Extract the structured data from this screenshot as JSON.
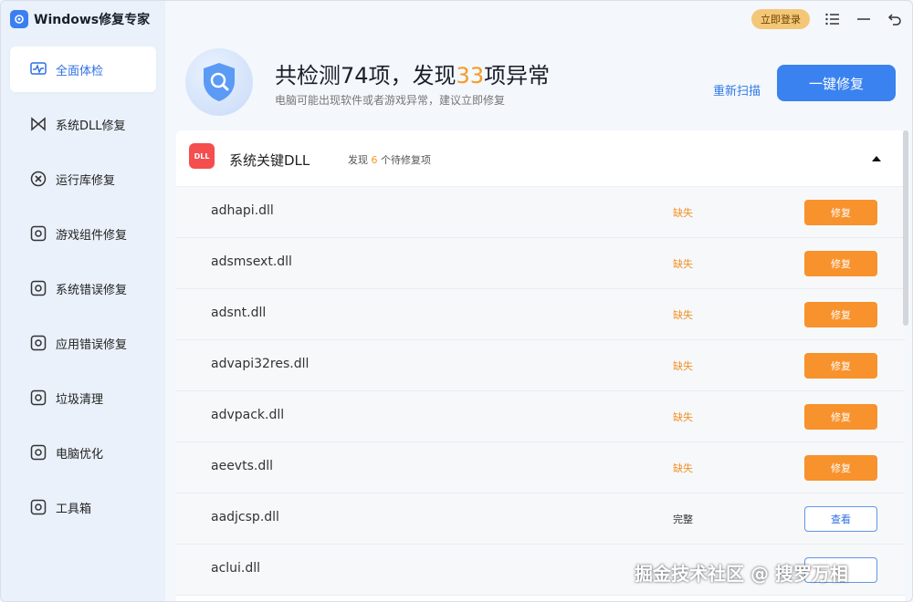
{
  "app": {
    "title": "Windows修复专家",
    "login_label": "立即登录"
  },
  "sidebar": {
    "items": [
      {
        "label": "全面体检",
        "icon": "pulse-monitor-icon",
        "active": true
      },
      {
        "label": "系统DLL修复",
        "icon": "bowtie-icon"
      },
      {
        "label": "运行库修复",
        "icon": "x-circle-icon"
      },
      {
        "label": "游戏组件修复",
        "icon": "gear-square-icon"
      },
      {
        "label": "系统错误修复",
        "icon": "gear-square-icon"
      },
      {
        "label": "应用错误修复",
        "icon": "gear-square-icon"
      },
      {
        "label": "垃圾清理",
        "icon": "gear-square-icon"
      },
      {
        "label": "电脑优化",
        "icon": "gear-square-icon"
      },
      {
        "label": "工具箱",
        "icon": "gear-square-icon"
      }
    ]
  },
  "header": {
    "summary_prefix": "共检测",
    "total": "74",
    "summary_mid": "项，发现",
    "abnormal": "33",
    "summary_suffix": "项异常",
    "subtitle": "电脑可能出现软件或者游戏异常，建议立即修复",
    "rescan_label": "重新扫描",
    "fix_all_label": "一键修复"
  },
  "section": {
    "title": "系统关键DLL",
    "icon_text": "DLL",
    "count_prefix": "发现",
    "count": "6",
    "count_suffix": "个待修复项"
  },
  "rows": [
    {
      "file": "adhapi.dll",
      "status": "缺失",
      "action": "修复",
      "kind": "repair"
    },
    {
      "file": "adsmsext.dll",
      "status": "缺失",
      "action": "修复",
      "kind": "repair"
    },
    {
      "file": "adsnt.dll",
      "status": "缺失",
      "action": "修复",
      "kind": "repair"
    },
    {
      "file": "advapi32res.dll",
      "status": "缺失",
      "action": "修复",
      "kind": "repair"
    },
    {
      "file": "advpack.dll",
      "status": "缺失",
      "action": "修复",
      "kind": "repair"
    },
    {
      "file": "aeevts.dll",
      "status": "缺失",
      "action": "修复",
      "kind": "repair"
    },
    {
      "file": "aadjcsp.dll",
      "status": "完整",
      "action": "查看",
      "kind": "view"
    },
    {
      "file": "aclui.dll",
      "status": "",
      "action": "",
      "kind": "view"
    }
  ],
  "watermark": "掘金技术社区 @ 搜罗万相",
  "colors": {
    "accent": "#3a82ef",
    "highlight": "#f59a23",
    "repair_button": "#f7922d",
    "login": "#f4c778"
  }
}
